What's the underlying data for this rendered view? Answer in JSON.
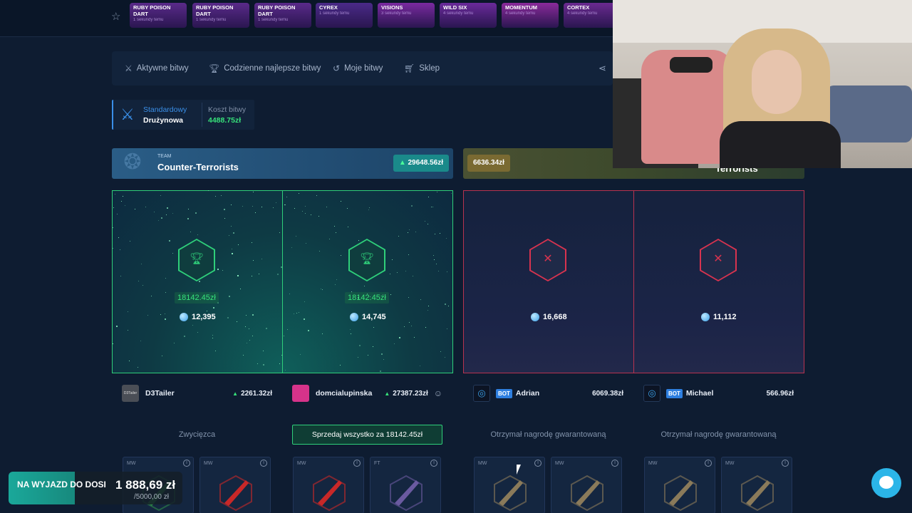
{
  "live_drops": [
    {
      "name": "RUBY POISON DART",
      "time": "1 sekundy temu",
      "color": "#5a2a8a"
    },
    {
      "name": "RUBY POISON DART",
      "time": "1 sekundy temu",
      "color": "#5a2a8a"
    },
    {
      "name": "RUBY POISON DART",
      "time": "1 sekundy temu",
      "color": "#5a2a8a"
    },
    {
      "name": "CYREX",
      "time": "1 sekundy temu",
      "color": "#4a2a88"
    },
    {
      "name": "VISIONS",
      "time": "3 sekundy temu",
      "color": "#7a2aa0"
    },
    {
      "name": "WILD SIX",
      "time": "4 sekundy temu",
      "color": "#6a2a9a"
    },
    {
      "name": "MOMENTUM",
      "time": "4 sekundy temu",
      "color": "#8a2a9a"
    },
    {
      "name": "CORTEX",
      "time": "4 sekundy temu",
      "color": "#6a2a90"
    }
  ],
  "nav": {
    "active_battles": "Aktywne bitwy",
    "daily_best": "Codzienne najlepsze bitwy",
    "my_battles": "Moje bitwy",
    "shop": "Sklep"
  },
  "mode": {
    "type": "Standardowy",
    "subtype": "Drużynowa",
    "cost_label": "Koszt bitwy",
    "cost_value": "4488.75zł"
  },
  "teams": {
    "ct": {
      "tag": "TEAM",
      "name": "Counter-Terrorists",
      "total": "29648.56zł"
    },
    "t": {
      "total": "6636.34zł",
      "name": "Terrorists"
    }
  },
  "slots": [
    {
      "result": "win",
      "value": "18142.45zł",
      "points": "12,395"
    },
    {
      "result": "win",
      "value": "18142.45zł",
      "points": "14,745"
    },
    {
      "result": "loss",
      "points": "16,668"
    },
    {
      "result": "loss",
      "points": "11,112"
    }
  ],
  "players": [
    {
      "name": "D3Tailer",
      "amount": "2261.32zł",
      "avatar_text": "D3Tailer"
    },
    {
      "name": "domcialupinska",
      "amount": "27387.23zł"
    },
    {
      "name": "Adrian",
      "amount": "6069.38zł",
      "bot": "BOT"
    },
    {
      "name": "Michael",
      "amount": "566.96zł",
      "bot": "BOT"
    }
  ],
  "sell_all": "Sprzedaj wszystko za 18142.45zł",
  "status": {
    "winner": "Zwycięzca",
    "guaranteed_a": "Otrzymał nagrodę gwarantowaną",
    "guaranteed_b": "Otrzymał nagrodę gwarantowaną"
  },
  "items": [
    {
      "quality": "MW",
      "color": "#2e8a4a"
    },
    {
      "quality": "MW",
      "color": "#c82828"
    },
    {
      "quality": "MW",
      "color": "#c82828"
    },
    {
      "quality": "FT",
      "color": "#6a5aa0"
    },
    {
      "quality": "MW",
      "color": "#8a7a5a"
    },
    {
      "quality": "MW",
      "color": "#8a7a5a"
    },
    {
      "quality": "MW",
      "color": "#8a7a5a"
    },
    {
      "quality": "MW",
      "color": "#8a7a5a"
    }
  ],
  "goal": {
    "label": "NA WYJAZD DO DOSI",
    "amount": "1 888,69 zł",
    "target": "/5000,00 zł",
    "progress": 0.38
  },
  "colors": {
    "win": "#2fcf7a",
    "loss": "#d8334f",
    "accent": "#3a8fe8"
  }
}
